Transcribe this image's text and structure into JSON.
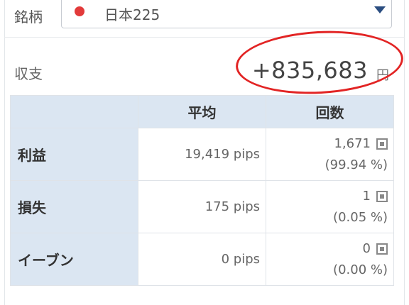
{
  "symbol": {
    "label": "銘柄",
    "value": "日本225",
    "flag_color": "#e23a3a"
  },
  "pnl": {
    "label": "収支",
    "value": "+835,683",
    "unit": "円"
  },
  "table": {
    "headers": [
      "",
      "平均",
      "回数"
    ],
    "rows": [
      {
        "label": "利益",
        "avg": "19,419 pips",
        "count": "1,671",
        "pct": "(99.94 %)"
      },
      {
        "label": "損失",
        "avg": "175 pips",
        "count": "1",
        "pct": "(0.05 %)"
      },
      {
        "label": "イーブン",
        "avg": "0 pips",
        "count": "0",
        "pct": "(0.00 %)"
      }
    ]
  },
  "colors": {
    "header_bg": "#dbe6f2",
    "highlight": "#e22424",
    "dropdown_arrow": "#2a4d80"
  },
  "icons": {
    "dropdown": "chevron-down-icon",
    "detail": "detail-icon"
  }
}
